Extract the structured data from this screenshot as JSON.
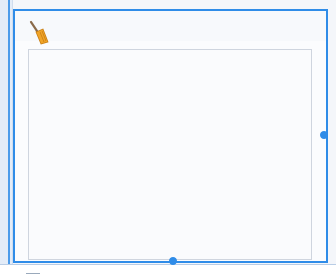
{
  "canvas": {
    "selection_color": "#2f8ce8",
    "background": "#f4f6fa"
  },
  "component": {
    "icon": "broom-icon",
    "icon_colors": {
      "bristles": "#f0a428",
      "handle": "#8a6a4a"
    }
  }
}
